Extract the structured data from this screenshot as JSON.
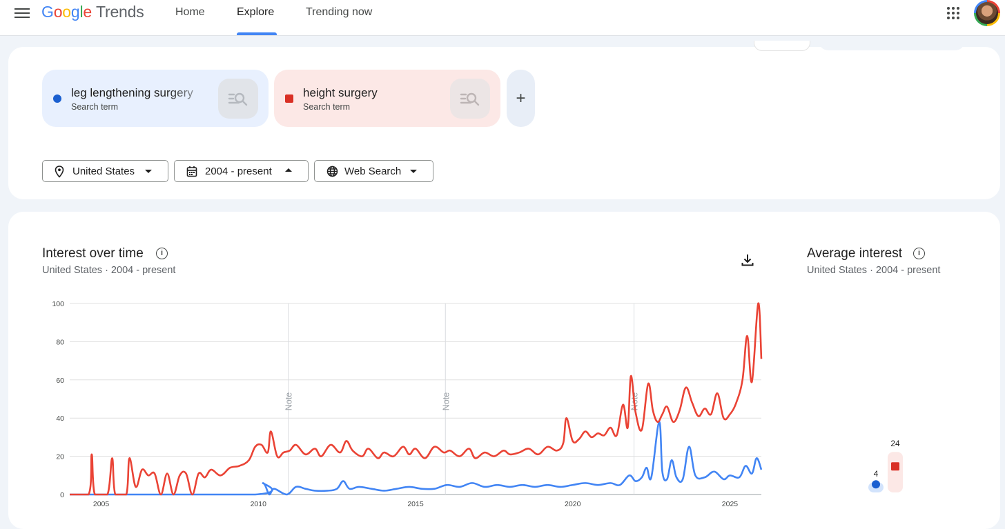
{
  "header": {
    "logo_google": [
      "G",
      "o",
      "o",
      "g",
      "l",
      "e"
    ],
    "logo_trends": "Trends",
    "tabs": [
      {
        "label": "Home"
      },
      {
        "label": "Explore"
      },
      {
        "label": "Trending now"
      }
    ],
    "active_tab": "Explore"
  },
  "terms": [
    {
      "name": "leg lengthening surgery",
      "type": "Search term",
      "color": "#1a5fd0"
    },
    {
      "name": "height surgery",
      "type": "Search term",
      "color": "#d93025"
    }
  ],
  "add_term_symbol": "+",
  "filters": {
    "region": "United States",
    "time": "2004 - present",
    "property": "Web Search"
  },
  "interest_over_time": {
    "title": "Interest over time",
    "subtitle": "United States  ·  2004 - present",
    "info_symbol": "i"
  },
  "average_interest": {
    "title": "Average interest",
    "subtitle": "United States  ·  2004 - present",
    "info_symbol": "i",
    "values": [
      {
        "term": "leg lengthening surgery",
        "value": 4,
        "color": "#1a5fd0"
      },
      {
        "term": "height surgery",
        "value": 24,
        "color": "#d93025"
      }
    ]
  },
  "chart_data": {
    "type": "line",
    "xlabel": "",
    "ylabel": "",
    "ylim": [
      0,
      100
    ],
    "yticks": [
      0,
      20,
      40,
      60,
      80,
      100
    ],
    "xticks": [
      "2005",
      "2010",
      "2015",
      "2020",
      "2025"
    ],
    "xlim_years": [
      2004.0,
      2026.0
    ],
    "grid": true,
    "notes": [
      {
        "year": 2010.95,
        "label": "Note"
      },
      {
        "year": 2015.95,
        "label": "Note"
      },
      {
        "year": 2021.95,
        "label": "Note"
      }
    ],
    "series": [
      {
        "color": "#4285f4",
        "points": [
          [
            2004.0,
            0
          ],
          [
            2009.9,
            0
          ],
          [
            2010.15,
            6
          ],
          [
            2010.35,
            0
          ],
          [
            2010.5,
            3
          ],
          [
            2010.9,
            0
          ],
          [
            2011.2,
            4
          ],
          [
            2011.5,
            3
          ],
          [
            2011.8,
            2
          ],
          [
            2012.2,
            2
          ],
          [
            2012.5,
            3
          ],
          [
            2012.7,
            7
          ],
          [
            2012.9,
            3
          ],
          [
            2013.2,
            4
          ],
          [
            2013.6,
            3
          ],
          [
            2014.0,
            2
          ],
          [
            2014.4,
            3
          ],
          [
            2014.8,
            4
          ],
          [
            2015.2,
            3
          ],
          [
            2015.6,
            3
          ],
          [
            2016.0,
            5
          ],
          [
            2016.4,
            4
          ],
          [
            2016.8,
            6
          ],
          [
            2017.2,
            4
          ],
          [
            2017.6,
            5
          ],
          [
            2018.0,
            4
          ],
          [
            2018.4,
            5
          ],
          [
            2018.8,
            4
          ],
          [
            2019.2,
            5
          ],
          [
            2019.6,
            4
          ],
          [
            2020.0,
            5
          ],
          [
            2020.4,
            6
          ],
          [
            2020.8,
            5
          ],
          [
            2021.2,
            6
          ],
          [
            2021.5,
            5
          ],
          [
            2021.8,
            10
          ],
          [
            2022.0,
            7
          ],
          [
            2022.2,
            9
          ],
          [
            2022.35,
            14
          ],
          [
            2022.5,
            9
          ],
          [
            2022.75,
            38
          ],
          [
            2022.85,
            12
          ],
          [
            2023.0,
            8
          ],
          [
            2023.15,
            18
          ],
          [
            2023.3,
            9
          ],
          [
            2023.5,
            8
          ],
          [
            2023.7,
            25
          ],
          [
            2023.9,
            10
          ],
          [
            2024.2,
            9
          ],
          [
            2024.5,
            12
          ],
          [
            2024.8,
            8
          ],
          [
            2025.0,
            10
          ],
          [
            2025.3,
            9
          ],
          [
            2025.5,
            15
          ],
          [
            2025.7,
            11
          ],
          [
            2025.85,
            19
          ],
          [
            2026.0,
            13
          ]
        ]
      },
      {
        "color": "#ea4335",
        "points": [
          [
            2004.0,
            0
          ],
          [
            2004.6,
            0
          ],
          [
            2004.7,
            21
          ],
          [
            2004.8,
            0
          ],
          [
            2005.2,
            0
          ],
          [
            2005.35,
            19
          ],
          [
            2005.45,
            0
          ],
          [
            2005.8,
            0
          ],
          [
            2005.9,
            19
          ],
          [
            2006.1,
            4
          ],
          [
            2006.3,
            13
          ],
          [
            2006.5,
            10
          ],
          [
            2006.7,
            11
          ],
          [
            2006.9,
            0
          ],
          [
            2007.1,
            11
          ],
          [
            2007.3,
            0
          ],
          [
            2007.5,
            10
          ],
          [
            2007.7,
            11
          ],
          [
            2007.9,
            0
          ],
          [
            2008.1,
            11
          ],
          [
            2008.3,
            9
          ],
          [
            2008.5,
            13
          ],
          [
            2008.8,
            10
          ],
          [
            2009.1,
            14
          ],
          [
            2009.4,
            15
          ],
          [
            2009.7,
            18
          ],
          [
            2009.9,
            25
          ],
          [
            2010.1,
            26
          ],
          [
            2010.3,
            22
          ],
          [
            2010.4,
            33
          ],
          [
            2010.6,
            20
          ],
          [
            2010.8,
            22
          ],
          [
            2011.0,
            23
          ],
          [
            2011.2,
            26
          ],
          [
            2011.5,
            21
          ],
          [
            2011.8,
            24
          ],
          [
            2012.0,
            20
          ],
          [
            2012.3,
            26
          ],
          [
            2012.6,
            22
          ],
          [
            2012.8,
            28
          ],
          [
            2013.0,
            23
          ],
          [
            2013.3,
            20
          ],
          [
            2013.5,
            24
          ],
          [
            2013.8,
            19
          ],
          [
            2014.0,
            22
          ],
          [
            2014.3,
            20
          ],
          [
            2014.6,
            25
          ],
          [
            2014.8,
            21
          ],
          [
            2015.0,
            24
          ],
          [
            2015.3,
            19
          ],
          [
            2015.6,
            25
          ],
          [
            2015.9,
            22
          ],
          [
            2016.1,
            23
          ],
          [
            2016.4,
            20
          ],
          [
            2016.7,
            24
          ],
          [
            2016.9,
            19
          ],
          [
            2017.2,
            22
          ],
          [
            2017.5,
            20
          ],
          [
            2017.8,
            23
          ],
          [
            2018.0,
            21
          ],
          [
            2018.3,
            22
          ],
          [
            2018.6,
            24
          ],
          [
            2018.9,
            21
          ],
          [
            2019.2,
            25
          ],
          [
            2019.5,
            23
          ],
          [
            2019.7,
            27
          ],
          [
            2019.8,
            40
          ],
          [
            2020.0,
            28
          ],
          [
            2020.2,
            29
          ],
          [
            2020.4,
            33
          ],
          [
            2020.6,
            30
          ],
          [
            2020.8,
            32
          ],
          [
            2021.0,
            31
          ],
          [
            2021.2,
            35
          ],
          [
            2021.4,
            31
          ],
          [
            2021.6,
            47
          ],
          [
            2021.75,
            35
          ],
          [
            2021.85,
            62
          ],
          [
            2022.0,
            43
          ],
          [
            2022.2,
            34
          ],
          [
            2022.4,
            58
          ],
          [
            2022.55,
            44
          ],
          [
            2022.7,
            38
          ],
          [
            2022.85,
            42
          ],
          [
            2023.0,
            46
          ],
          [
            2023.2,
            38
          ],
          [
            2023.4,
            44
          ],
          [
            2023.6,
            56
          ],
          [
            2023.8,
            48
          ],
          [
            2024.0,
            41
          ],
          [
            2024.2,
            45
          ],
          [
            2024.4,
            42
          ],
          [
            2024.6,
            53
          ],
          [
            2024.8,
            40
          ],
          [
            2025.0,
            42
          ],
          [
            2025.2,
            48
          ],
          [
            2025.4,
            60
          ],
          [
            2025.55,
            83
          ],
          [
            2025.7,
            59
          ],
          [
            2025.9,
            100
          ],
          [
            2026.0,
            71
          ]
        ]
      }
    ]
  }
}
